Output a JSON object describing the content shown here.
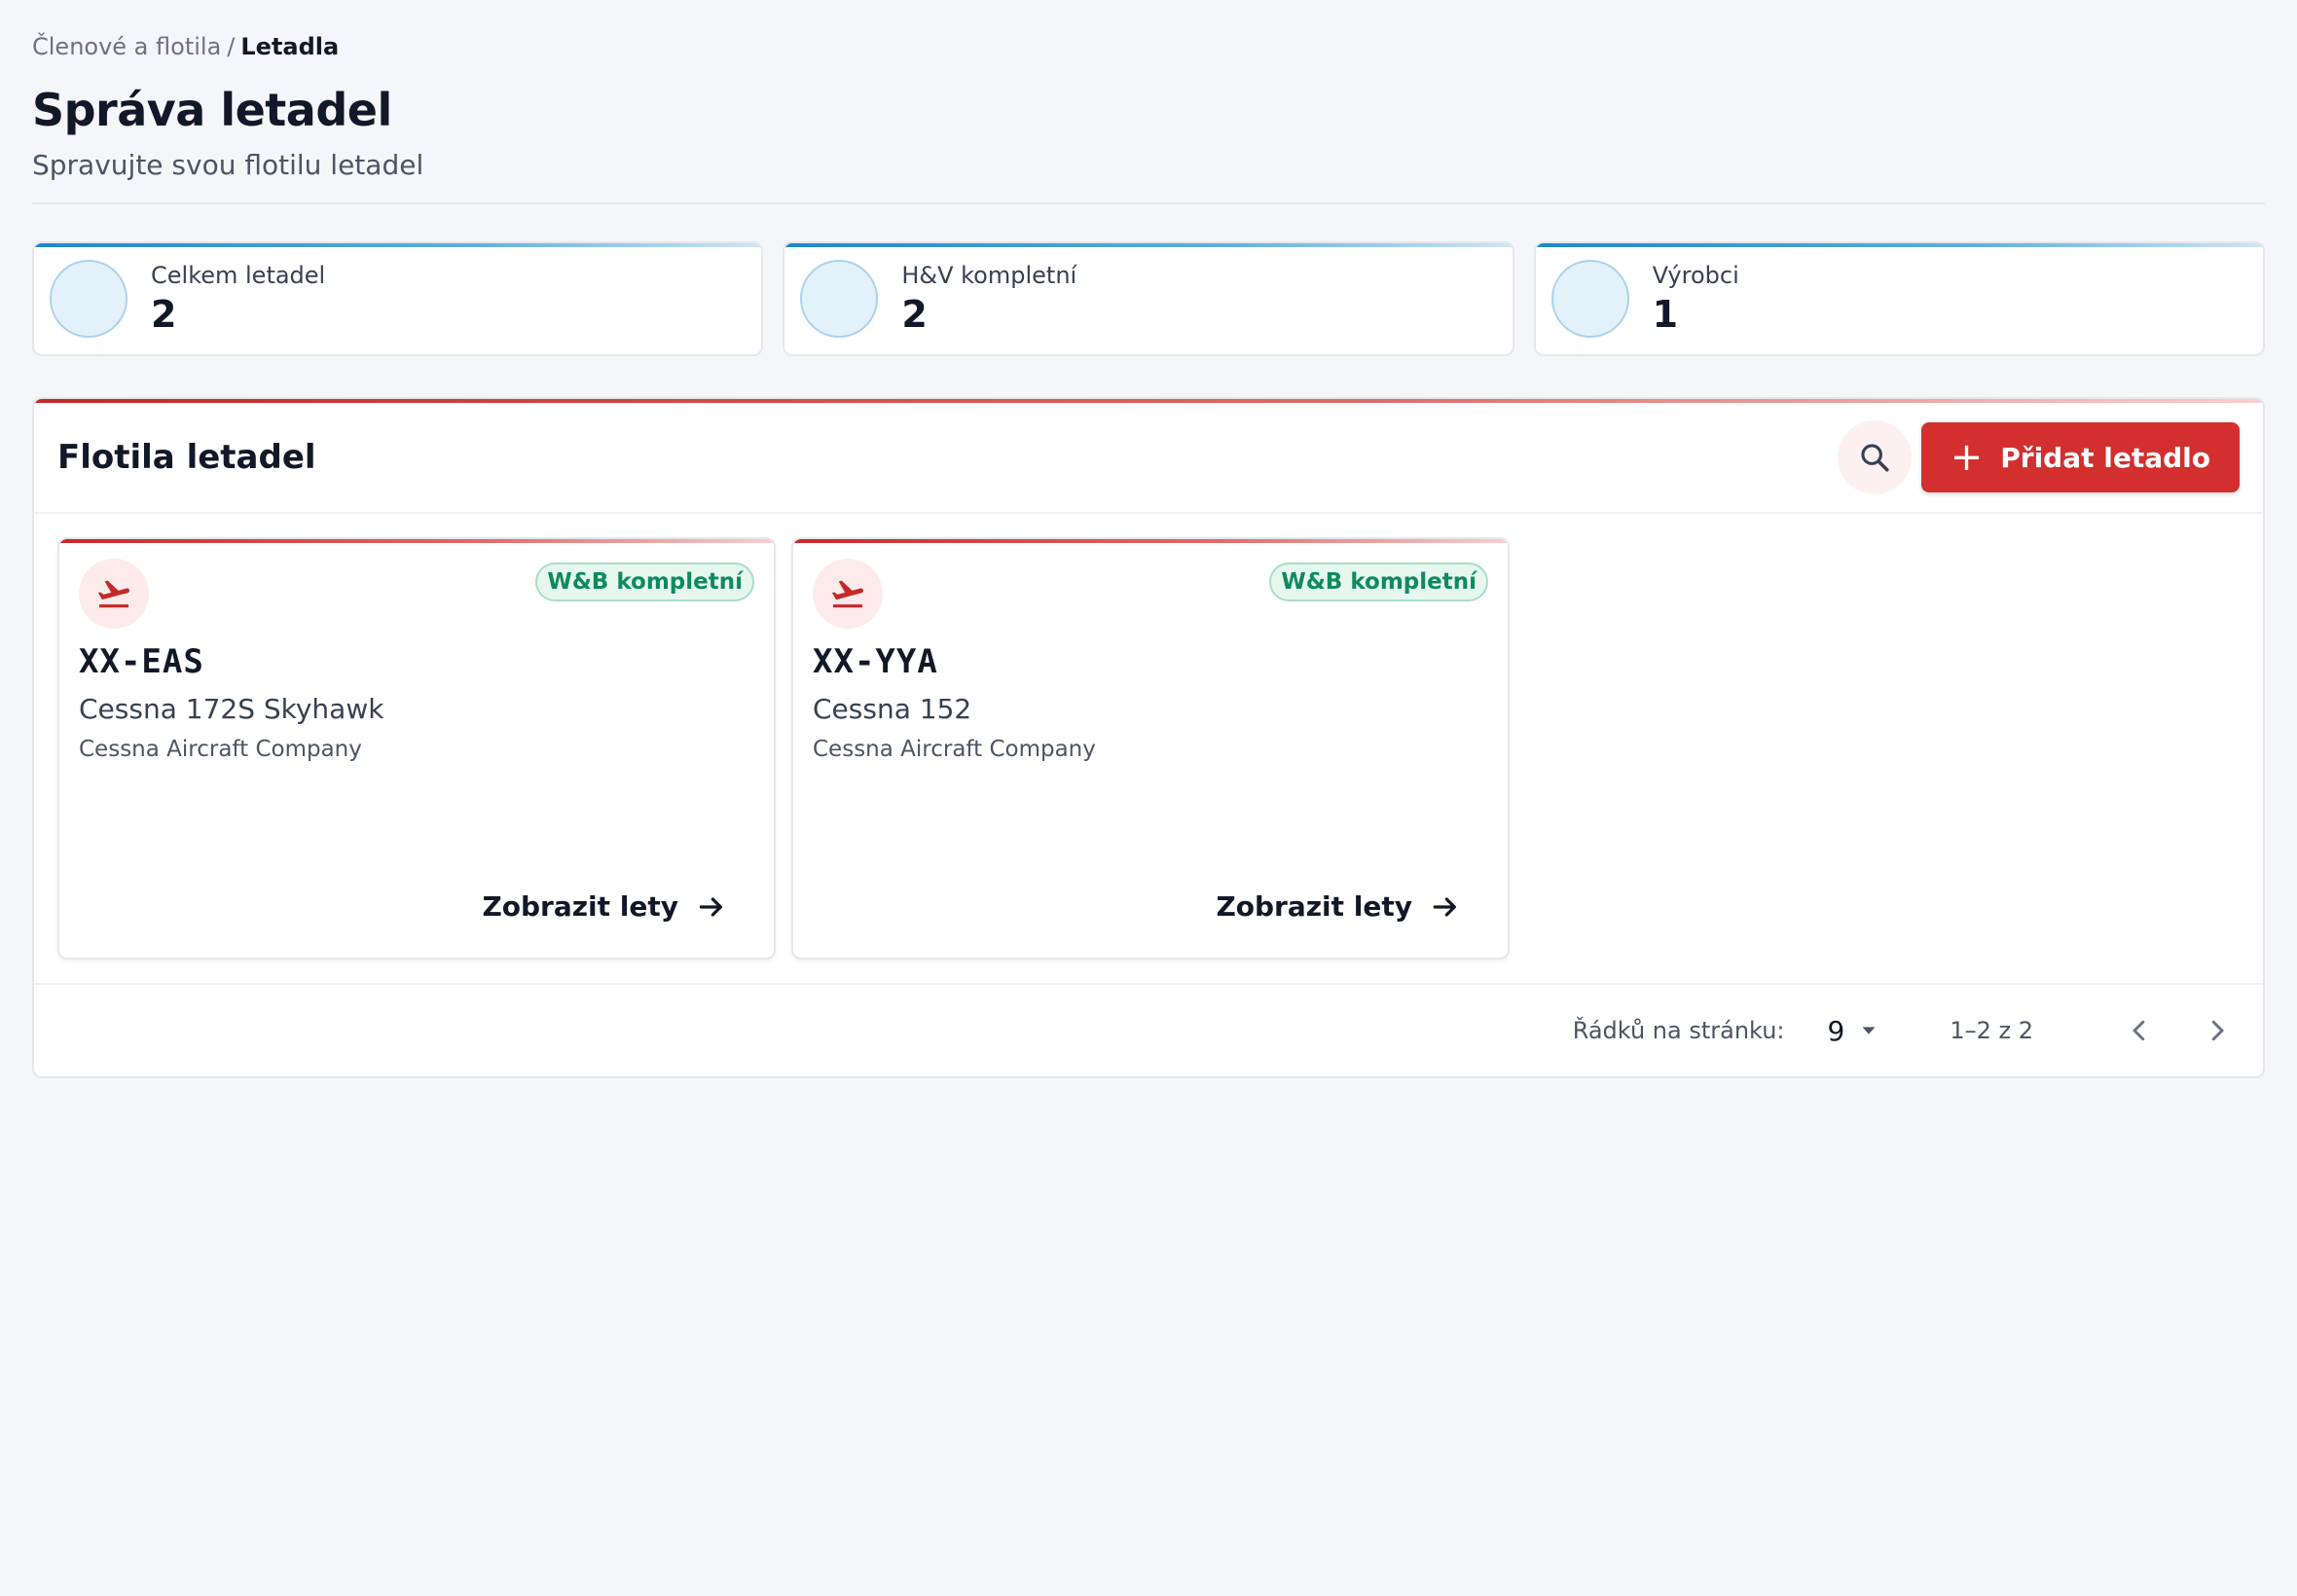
{
  "breadcrumb": {
    "parent": "Členové a flotila",
    "separator": "/",
    "current": "Letadla"
  },
  "header": {
    "title": "Správa letadel",
    "subtitle": "Spravujte svou flotilu letadel"
  },
  "stats": [
    {
      "label": "Celkem letadel",
      "value": "2"
    },
    {
      "label": "H&V kompletní",
      "value": "2"
    },
    {
      "label": "Výrobci",
      "value": "1"
    }
  ],
  "fleet": {
    "title": "Flotila letadel",
    "add_label": "Přidat letadlo",
    "aircraft": [
      {
        "badge": "W&B kompletní",
        "registration": "XX-EAS",
        "model": "Cessna 172S Skyhawk",
        "manufacturer": "Cessna Aircraft Company",
        "action": "Zobrazit lety"
      },
      {
        "badge": "W&B kompletní",
        "registration": "XX-YYA",
        "model": "Cessna 152",
        "manufacturer": "Cessna Aircraft Company",
        "action": "Zobrazit lety"
      }
    ]
  },
  "pagination": {
    "rows_label": "Řádků na stránku:",
    "rows_value": "9",
    "range": "1–2 z 2"
  },
  "colors": {
    "accent": "#d32f2f",
    "info": "#1e88c9",
    "success": "#0f8a5f"
  }
}
